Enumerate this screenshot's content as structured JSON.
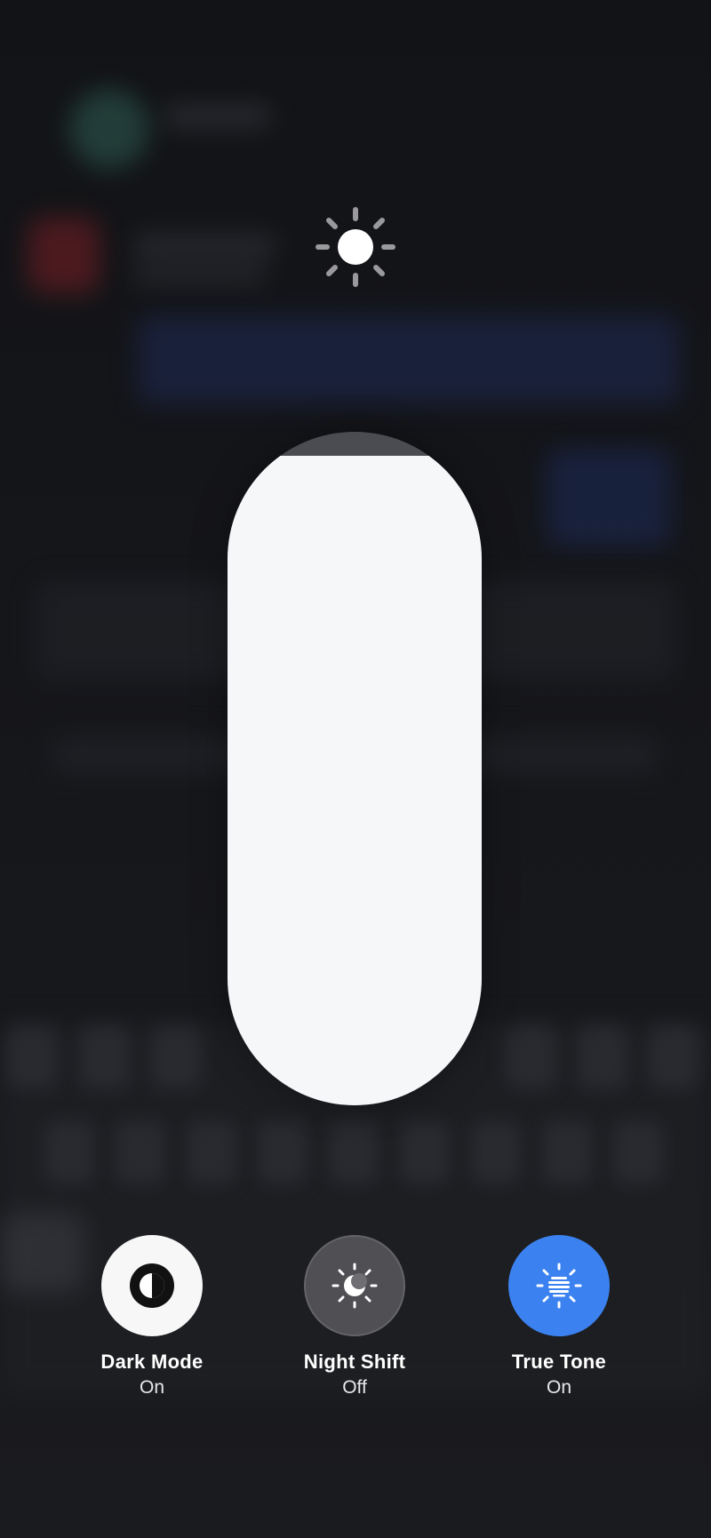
{
  "brightness": {
    "icon": "sun-icon",
    "level_percent": 96.5
  },
  "controls": [
    {
      "icon": "dark-mode-icon",
      "label": "Dark Mode",
      "state": "On",
      "active_color": "#f7f7f8"
    },
    {
      "icon": "night-shift-icon",
      "label": "Night Shift",
      "state": "Off",
      "active_color": "#7a7a7f"
    },
    {
      "icon": "true-tone-icon",
      "label": "True Tone",
      "state": "On",
      "active_color": "#3b82f0"
    }
  ]
}
